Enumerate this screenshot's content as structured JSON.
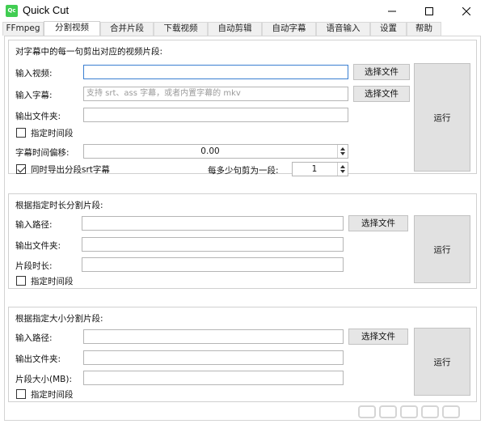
{
  "window": {
    "title": "Quick Cut",
    "icon_text": "Qc"
  },
  "tabs": [
    {
      "label": "FFmpeg"
    },
    {
      "label": "分割视频",
      "active": true
    },
    {
      "label": "合并片段"
    },
    {
      "label": "下载视频"
    },
    {
      "label": "自动剪辑"
    },
    {
      "label": "自动字幕"
    },
    {
      "label": "语音输入"
    },
    {
      "label": "设置"
    },
    {
      "label": "帮助"
    }
  ],
  "section1": {
    "title": "对字幕中的每一句剪出对应的视频片段:",
    "video_label": "输入视频:",
    "video_value": "",
    "subtitle_label": "输入字幕:",
    "subtitle_placeholder": "支持 srt、ass 字幕，或者内置字幕的 mkv",
    "output_label": "输出文件夹:",
    "output_value": "",
    "choose_video_button": "选择文件",
    "choose_subtitle_button": "选择文件",
    "time_range_label": "指定时间段",
    "offset_label": "字幕时间偏移:",
    "offset_value": "0.00",
    "export_srt_label": "同时导出分段srt字幕",
    "sentences_label": "每多少句剪为一段:",
    "sentences_value": "1",
    "run_button": "运行"
  },
  "section2": {
    "title": "根据指定时长分割片段:",
    "input_label": "输入路径:",
    "output_label": "输出文件夹:",
    "duration_label": "片段时长:",
    "choose_button": "选择文件",
    "time_range_label": "指定时间段",
    "run_button": "运行"
  },
  "section3": {
    "title": "根据指定大小分割片段:",
    "input_label": "输入路径:",
    "output_label": "输出文件夹:",
    "size_label": "片段大小(MB):",
    "choose_button": "选择文件",
    "time_range_label": "指定时间段",
    "run_button": "运行"
  },
  "colors": {
    "app_icon": "#41cd52",
    "focus_border": "#3b7fd1",
    "button_bg": "#e6e6e6"
  },
  "icons": [
    "app-logo-icon",
    "minimize-icon",
    "maximize-icon",
    "close-icon",
    "spin-up-icon",
    "spin-down-icon"
  ]
}
